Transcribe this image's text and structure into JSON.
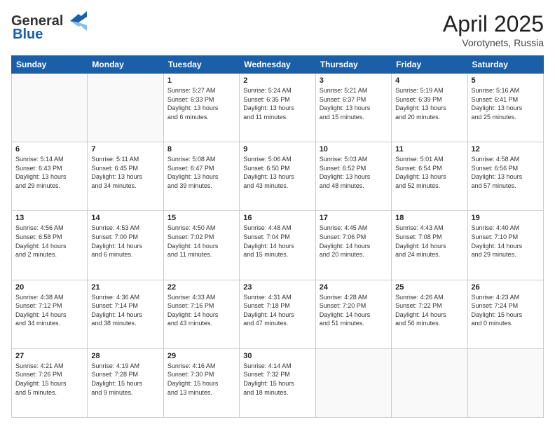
{
  "header": {
    "logo_general": "General",
    "logo_blue": "Blue",
    "month": "April 2025",
    "location": "Vorotynets, Russia"
  },
  "days_of_week": [
    "Sunday",
    "Monday",
    "Tuesday",
    "Wednesday",
    "Thursday",
    "Friday",
    "Saturday"
  ],
  "weeks": [
    [
      {
        "day": "",
        "info": ""
      },
      {
        "day": "",
        "info": ""
      },
      {
        "day": "1",
        "info": "Sunrise: 5:27 AM\nSunset: 6:33 PM\nDaylight: 13 hours\nand 6 minutes."
      },
      {
        "day": "2",
        "info": "Sunrise: 5:24 AM\nSunset: 6:35 PM\nDaylight: 13 hours\nand 11 minutes."
      },
      {
        "day": "3",
        "info": "Sunrise: 5:21 AM\nSunset: 6:37 PM\nDaylight: 13 hours\nand 15 minutes."
      },
      {
        "day": "4",
        "info": "Sunrise: 5:19 AM\nSunset: 6:39 PM\nDaylight: 13 hours\nand 20 minutes."
      },
      {
        "day": "5",
        "info": "Sunrise: 5:16 AM\nSunset: 6:41 PM\nDaylight: 13 hours\nand 25 minutes."
      }
    ],
    [
      {
        "day": "6",
        "info": "Sunrise: 5:14 AM\nSunset: 6:43 PM\nDaylight: 13 hours\nand 29 minutes."
      },
      {
        "day": "7",
        "info": "Sunrise: 5:11 AM\nSunset: 6:45 PM\nDaylight: 13 hours\nand 34 minutes."
      },
      {
        "day": "8",
        "info": "Sunrise: 5:08 AM\nSunset: 6:47 PM\nDaylight: 13 hours\nand 39 minutes."
      },
      {
        "day": "9",
        "info": "Sunrise: 5:06 AM\nSunset: 6:50 PM\nDaylight: 13 hours\nand 43 minutes."
      },
      {
        "day": "10",
        "info": "Sunrise: 5:03 AM\nSunset: 6:52 PM\nDaylight: 13 hours\nand 48 minutes."
      },
      {
        "day": "11",
        "info": "Sunrise: 5:01 AM\nSunset: 6:54 PM\nDaylight: 13 hours\nand 52 minutes."
      },
      {
        "day": "12",
        "info": "Sunrise: 4:58 AM\nSunset: 6:56 PM\nDaylight: 13 hours\nand 57 minutes."
      }
    ],
    [
      {
        "day": "13",
        "info": "Sunrise: 4:56 AM\nSunset: 6:58 PM\nDaylight: 14 hours\nand 2 minutes."
      },
      {
        "day": "14",
        "info": "Sunrise: 4:53 AM\nSunset: 7:00 PM\nDaylight: 14 hours\nand 6 minutes."
      },
      {
        "day": "15",
        "info": "Sunrise: 4:50 AM\nSunset: 7:02 PM\nDaylight: 14 hours\nand 11 minutes."
      },
      {
        "day": "16",
        "info": "Sunrise: 4:48 AM\nSunset: 7:04 PM\nDaylight: 14 hours\nand 15 minutes."
      },
      {
        "day": "17",
        "info": "Sunrise: 4:45 AM\nSunset: 7:06 PM\nDaylight: 14 hours\nand 20 minutes."
      },
      {
        "day": "18",
        "info": "Sunrise: 4:43 AM\nSunset: 7:08 PM\nDaylight: 14 hours\nand 24 minutes."
      },
      {
        "day": "19",
        "info": "Sunrise: 4:40 AM\nSunset: 7:10 PM\nDaylight: 14 hours\nand 29 minutes."
      }
    ],
    [
      {
        "day": "20",
        "info": "Sunrise: 4:38 AM\nSunset: 7:12 PM\nDaylight: 14 hours\nand 34 minutes."
      },
      {
        "day": "21",
        "info": "Sunrise: 4:36 AM\nSunset: 7:14 PM\nDaylight: 14 hours\nand 38 minutes."
      },
      {
        "day": "22",
        "info": "Sunrise: 4:33 AM\nSunset: 7:16 PM\nDaylight: 14 hours\nand 43 minutes."
      },
      {
        "day": "23",
        "info": "Sunrise: 4:31 AM\nSunset: 7:18 PM\nDaylight: 14 hours\nand 47 minutes."
      },
      {
        "day": "24",
        "info": "Sunrise: 4:28 AM\nSunset: 7:20 PM\nDaylight: 14 hours\nand 51 minutes."
      },
      {
        "day": "25",
        "info": "Sunrise: 4:26 AM\nSunset: 7:22 PM\nDaylight: 14 hours\nand 56 minutes."
      },
      {
        "day": "26",
        "info": "Sunrise: 4:23 AM\nSunset: 7:24 PM\nDaylight: 15 hours\nand 0 minutes."
      }
    ],
    [
      {
        "day": "27",
        "info": "Sunrise: 4:21 AM\nSunset: 7:26 PM\nDaylight: 15 hours\nand 5 minutes."
      },
      {
        "day": "28",
        "info": "Sunrise: 4:19 AM\nSunset: 7:28 PM\nDaylight: 15 hours\nand 9 minutes."
      },
      {
        "day": "29",
        "info": "Sunrise: 4:16 AM\nSunset: 7:30 PM\nDaylight: 15 hours\nand 13 minutes."
      },
      {
        "day": "30",
        "info": "Sunrise: 4:14 AM\nSunset: 7:32 PM\nDaylight: 15 hours\nand 18 minutes."
      },
      {
        "day": "",
        "info": ""
      },
      {
        "day": "",
        "info": ""
      },
      {
        "day": "",
        "info": ""
      }
    ]
  ]
}
